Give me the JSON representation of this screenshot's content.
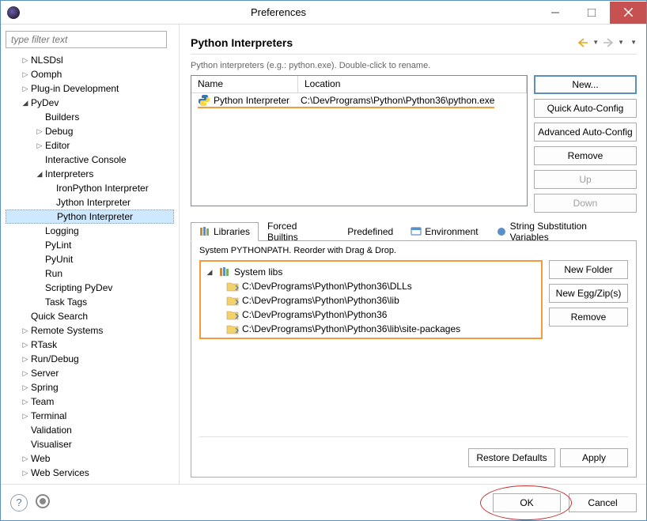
{
  "window": {
    "title": "Preferences"
  },
  "filter_placeholder": "type filter text",
  "tree": [
    {
      "label": "NLSDsl",
      "lvl": 1,
      "exp": "▷"
    },
    {
      "label": "Oomph",
      "lvl": 1,
      "exp": "▷"
    },
    {
      "label": "Plug-in Development",
      "lvl": 1,
      "exp": "▷"
    },
    {
      "label": "PyDev",
      "lvl": 1,
      "exp": "◢"
    },
    {
      "label": "Builders",
      "lvl": 2,
      "exp": ""
    },
    {
      "label": "Debug",
      "lvl": 2,
      "exp": "▷"
    },
    {
      "label": "Editor",
      "lvl": 2,
      "exp": "▷"
    },
    {
      "label": "Interactive Console",
      "lvl": 2,
      "exp": ""
    },
    {
      "label": "Interpreters",
      "lvl": 2,
      "exp": "◢"
    },
    {
      "label": "IronPython Interpreter",
      "lvl": 3,
      "exp": ""
    },
    {
      "label": "Jython Interpreter",
      "lvl": 3,
      "exp": ""
    },
    {
      "label": "Python Interpreter",
      "lvl": 3,
      "exp": "",
      "selected": true
    },
    {
      "label": "Logging",
      "lvl": 2,
      "exp": ""
    },
    {
      "label": "PyLint",
      "lvl": 2,
      "exp": ""
    },
    {
      "label": "PyUnit",
      "lvl": 2,
      "exp": ""
    },
    {
      "label": "Run",
      "lvl": 2,
      "exp": ""
    },
    {
      "label": "Scripting PyDev",
      "lvl": 2,
      "exp": ""
    },
    {
      "label": "Task Tags",
      "lvl": 2,
      "exp": ""
    },
    {
      "label": "Quick Search",
      "lvl": 1,
      "exp": ""
    },
    {
      "label": "Remote Systems",
      "lvl": 1,
      "exp": "▷"
    },
    {
      "label": "RTask",
      "lvl": 1,
      "exp": "▷"
    },
    {
      "label": "Run/Debug",
      "lvl": 1,
      "exp": "▷"
    },
    {
      "label": "Server",
      "lvl": 1,
      "exp": "▷"
    },
    {
      "label": "Spring",
      "lvl": 1,
      "exp": "▷"
    },
    {
      "label": "Team",
      "lvl": 1,
      "exp": "▷"
    },
    {
      "label": "Terminal",
      "lvl": 1,
      "exp": "▷"
    },
    {
      "label": "Validation",
      "lvl": 1,
      "exp": ""
    },
    {
      "label": "Visualiser",
      "lvl": 1,
      "exp": ""
    },
    {
      "label": "Web",
      "lvl": 1,
      "exp": "▷"
    },
    {
      "label": "Web Services",
      "lvl": 1,
      "exp": "▷"
    }
  ],
  "page": {
    "title": "Python Interpreters",
    "subtitle": "Python interpreters (e.g.: python.exe).   Double-click to rename.",
    "table": {
      "col_name": "Name",
      "col_location": "Location",
      "row_name": "Python Interpreter",
      "row_location": "C:\\DevPrograms\\Python\\Python36\\python.exe"
    },
    "buttons": {
      "new": "New...",
      "quick": "Quick Auto-Config",
      "advanced": "Advanced Auto-Config",
      "remove": "Remove",
      "up": "Up",
      "down": "Down"
    },
    "tabs": {
      "libraries": "Libraries",
      "forced": "Forced Builtins",
      "predefined": "Predefined",
      "environment": "Environment",
      "string_sub": "String Substitution Variables"
    },
    "pythonpath_label": "System PYTHONPATH.   Reorder with Drag & Drop.",
    "syslibs_label": "System libs",
    "libs": [
      "C:\\DevPrograms\\Python\\Python36\\DLLs",
      "C:\\DevPrograms\\Python\\Python36\\lib",
      "C:\\DevPrograms\\Python\\Python36",
      "C:\\DevPrograms\\Python\\Python36\\lib\\site-packages"
    ],
    "lib_buttons": {
      "new_folder": "New Folder",
      "new_egg": "New Egg/Zip(s)",
      "remove": "Remove"
    },
    "restore": "Restore Defaults",
    "apply": "Apply"
  },
  "footer": {
    "ok": "OK",
    "cancel": "Cancel"
  }
}
